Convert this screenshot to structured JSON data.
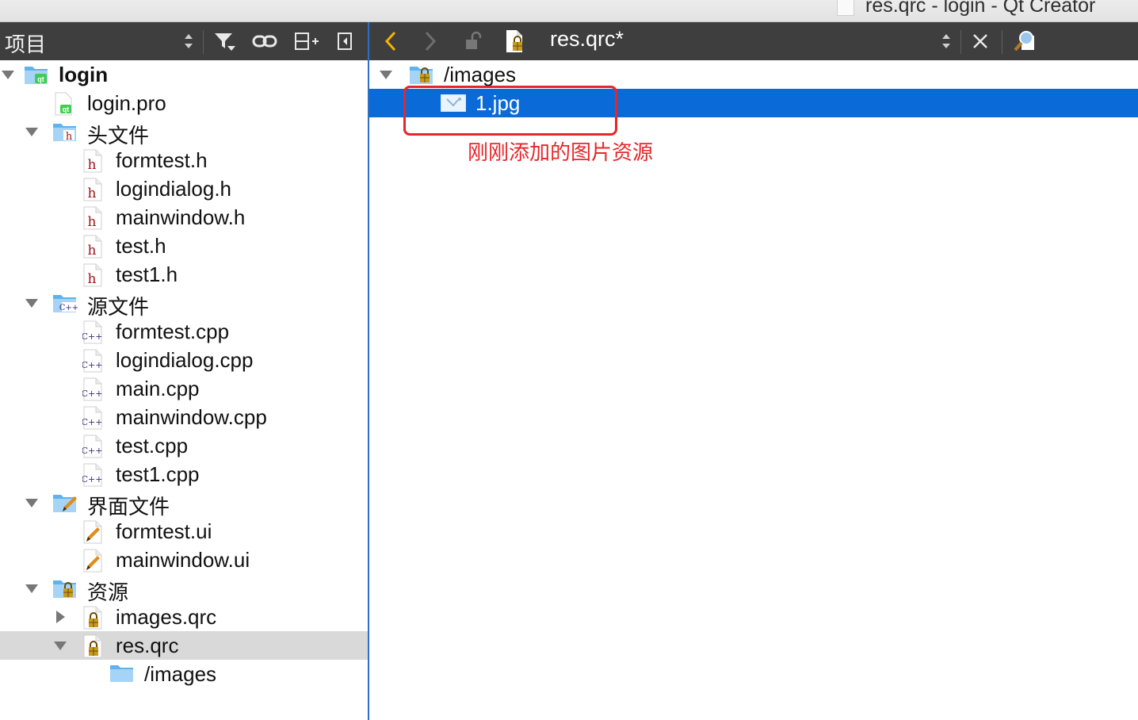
{
  "window": {
    "title": "res.qrc - login - Qt Creator"
  },
  "left_toolbar": {
    "label": "项目"
  },
  "right_toolbar": {
    "file_tab": "res.qrc*"
  },
  "tree": [
    {
      "label": "login",
      "bold": true,
      "arrow": "down",
      "icon": "qt-project-folder-icon",
      "level": 0
    },
    {
      "label": "login.pro",
      "icon": "qt-pro-file-icon",
      "level": 1
    },
    {
      "label": "头文件",
      "arrow": "down",
      "icon": "header-folder-icon",
      "level": 1
    },
    {
      "label": "formtest.h",
      "icon": "header-file-icon",
      "level": 2
    },
    {
      "label": "logindialog.h",
      "icon": "header-file-icon",
      "level": 2
    },
    {
      "label": "mainwindow.h",
      "icon": "header-file-icon",
      "level": 2
    },
    {
      "label": "test.h",
      "icon": "header-file-icon",
      "level": 2
    },
    {
      "label": "test1.h",
      "icon": "header-file-icon",
      "level": 2
    },
    {
      "label": "源文件",
      "arrow": "down",
      "icon": "source-folder-icon",
      "level": 1
    },
    {
      "label": "formtest.cpp",
      "icon": "cpp-file-icon",
      "level": 2
    },
    {
      "label": "logindialog.cpp",
      "icon": "cpp-file-icon",
      "level": 2
    },
    {
      "label": "main.cpp",
      "icon": "cpp-file-icon",
      "level": 2
    },
    {
      "label": "mainwindow.cpp",
      "icon": "cpp-file-icon",
      "level": 2
    },
    {
      "label": "test.cpp",
      "icon": "cpp-file-icon",
      "level": 2
    },
    {
      "label": "test1.cpp",
      "icon": "cpp-file-icon",
      "level": 2
    },
    {
      "label": "界面文件",
      "arrow": "down",
      "icon": "form-folder-icon",
      "level": 1
    },
    {
      "label": "formtest.ui",
      "icon": "ui-file-icon",
      "level": 2
    },
    {
      "label": "mainwindow.ui",
      "icon": "ui-file-icon",
      "level": 2
    },
    {
      "label": "资源",
      "arrow": "down",
      "icon": "resource-folder-icon",
      "level": 1
    },
    {
      "label": "images.qrc",
      "arrow": "right",
      "icon": "qrc-file-icon",
      "level": 2
    },
    {
      "label": "res.qrc",
      "arrow": "down",
      "icon": "qrc-file-icon",
      "level": 2,
      "selected": true
    },
    {
      "label": "/images",
      "icon": "folder-icon",
      "level": 3
    }
  ],
  "editor": {
    "prefix": "/images",
    "file": "1.jpg",
    "annotation": "刚刚添加的图片资源"
  },
  "colors": {
    "toolbar_bg": "#3e3e3e",
    "selection_blue": "#0a6bd8",
    "annotation_red": "#e8262a",
    "selected_row": "#d9d9d9"
  }
}
